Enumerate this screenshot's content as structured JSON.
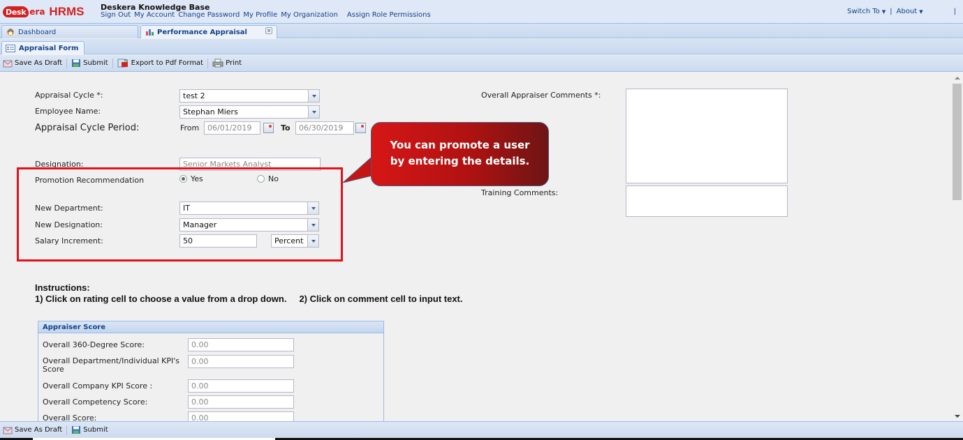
{
  "header": {
    "logo": {
      "cloud_text": "Desk",
      "era_text": "era",
      "product": "HRMS"
    },
    "kb_title": "Deskera Knowledge Base",
    "links": [
      "Sign Out",
      "My Account",
      "Change Password",
      "My Profile",
      "My Organization",
      "Assign Role Permissions"
    ],
    "right_menu": {
      "switch_to": "Switch To",
      "about": "About",
      "separator": "|"
    }
  },
  "tabs": [
    {
      "label": "Dashboard",
      "icon": "dashboard-icon",
      "active": false
    },
    {
      "label": "Performance Appraisal",
      "icon": "appraisal-chart-icon",
      "active": true,
      "closable": true,
      "close_glyph": "×"
    }
  ],
  "subtab": {
    "label": "Appraisal Form",
    "icon": "form-icon"
  },
  "toolbar": {
    "save_draft": "Save As Draft",
    "submit": "Submit",
    "export_pdf": "Export to Pdf Format",
    "print": "Print"
  },
  "form": {
    "appraisal_cycle": {
      "label": "Appraisal Cycle *:",
      "value": "test 2"
    },
    "employee_name": {
      "label": "Employee Name:",
      "value": "Stephan Miers"
    },
    "cycle_period": {
      "label": "Appraisal Cycle Period:",
      "from_label": "From",
      "from_value": "06/01/2019",
      "to_label": "To",
      "to_value": "06/30/2019"
    },
    "designation": {
      "label": "Designation:",
      "value": "Senior Markets Analyst"
    },
    "promotion": {
      "label": "Promotion Recommendation",
      "yes": "Yes",
      "no": "No",
      "selected": "Yes"
    },
    "new_department": {
      "label": "New Department:",
      "value": "IT"
    },
    "new_designation": {
      "label": "New Designation:",
      "value": "Manager"
    },
    "salary_increment": {
      "label": "Salary Increment:",
      "value": "50",
      "unit": "Percent"
    },
    "overall_comments": {
      "label": "Overall Appraiser Comments *:",
      "value": ""
    },
    "training_comments": {
      "label": "Training Comments:",
      "value": ""
    }
  },
  "callout": {
    "line1": "You can promote a user",
    "line2": "by entering the details.",
    "highlight_color": "#e0121b"
  },
  "instructions": {
    "title": "Instructions:",
    "step1": "1) Click on rating cell to choose a value from a drop down.",
    "step2": "2) Click on comment cell to input text."
  },
  "appraiser_score": {
    "title": "Appraiser Score",
    "rows": [
      {
        "label": "Overall 360-Degree Score:",
        "value": "0.00"
      },
      {
        "label_line1": "Overall Department/Individual KPI's",
        "label_line2": "Score",
        "value": "0.00"
      },
      {
        "label": "Overall Company KPI Score :",
        "value": "0.00"
      },
      {
        "label": "Overall Competency Score:",
        "value": "0.00"
      },
      {
        "label": "Overall Score:",
        "value": "0.00"
      }
    ]
  },
  "bottom_toolbar": {
    "save_draft": "Save As Draft",
    "submit": "Submit"
  }
}
